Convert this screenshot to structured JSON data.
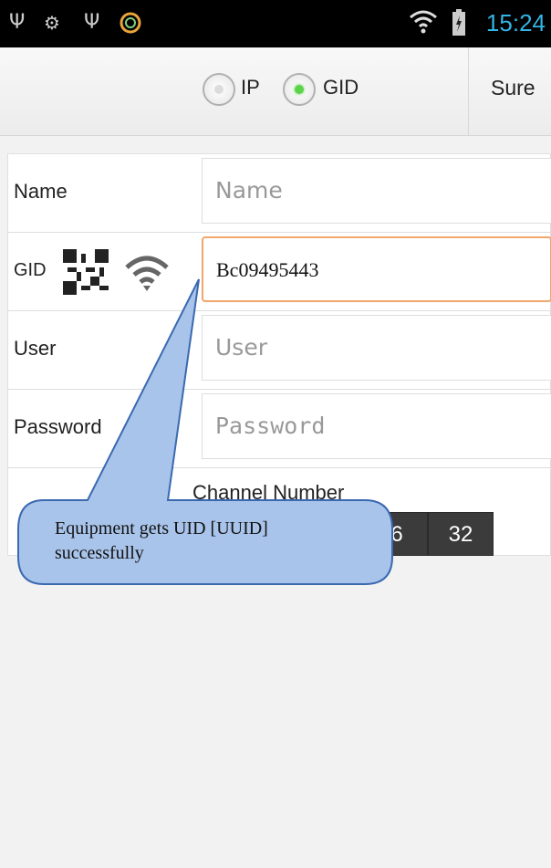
{
  "status_bar": {
    "time": "15:24",
    "icons": [
      "usb-icon",
      "android-debug-icon",
      "usb-icon",
      "app-icon",
      "wifi-icon",
      "battery-icon"
    ]
  },
  "mode_toggle": {
    "options": [
      {
        "label": "IP",
        "selected": false
      },
      {
        "label": "GID",
        "selected": true
      }
    ],
    "confirm_label": "Sure"
  },
  "form": {
    "name": {
      "label": "Name",
      "placeholder": "Name"
    },
    "gid": {
      "label": "GID",
      "value": "Bc09495443"
    },
    "user": {
      "label": "User",
      "placeholder": "User"
    },
    "password": {
      "label": "Password",
      "placeholder": "Password"
    },
    "channel": {
      "title": "Channel Number",
      "options": [
        "6",
        "32"
      ]
    }
  },
  "callout": {
    "text_line1": "Equipment gets UID [UUID]",
    "text_line2": "successfully",
    "fill_color": "#a9c4ea",
    "border_color": "#3a69b0"
  },
  "colors": {
    "status_time": "#33b5e5",
    "radio_selected": "#5cd44a",
    "focus_border": "#f0a66c"
  }
}
